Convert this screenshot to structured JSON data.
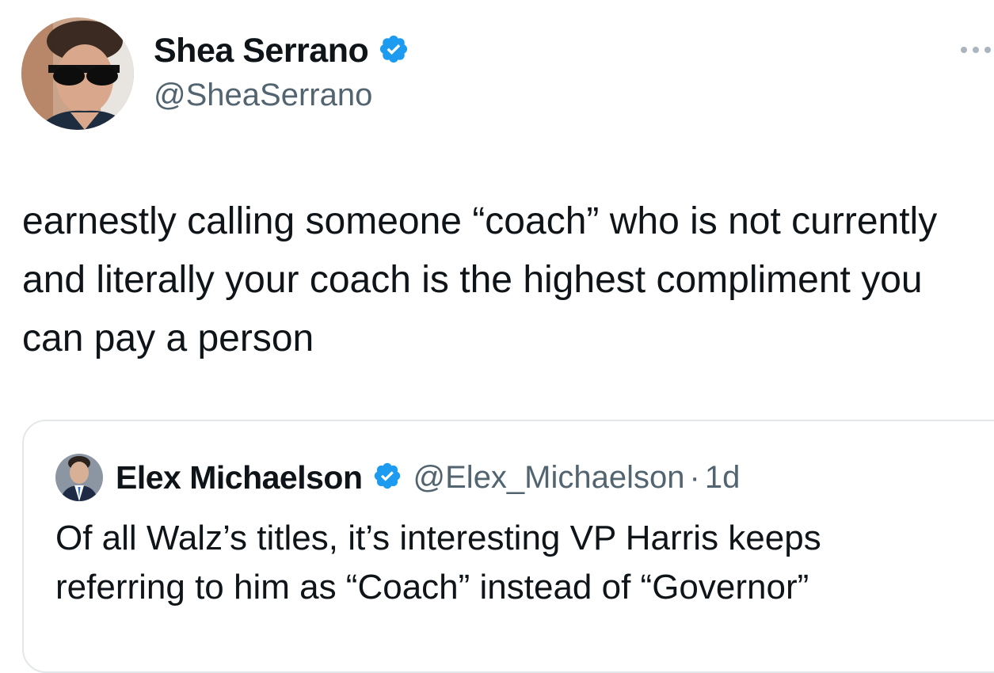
{
  "tweet": {
    "author": {
      "name": "Shea Serrano",
      "handle": "@SheaSerrano",
      "verified": true
    },
    "text": "earnestly calling someone “coach” who is not currently and literally your coach is the highest compliment you can pay a person",
    "more_icon": "more-horizontal-icon"
  },
  "quoted_tweet": {
    "author": {
      "name": "Elex Michaelson",
      "handle": "@Elex_Michaelson",
      "verified": true
    },
    "separator": "·",
    "time": "1d",
    "text": "Of all Walz’s titles, it’s interesting VP Harris keeps referring to him as “Coach” instead of “Governor”"
  },
  "colors": {
    "verified_blue": "#1d9bf0",
    "secondary_text": "#536471",
    "primary_text": "#0f1419",
    "border": "#e3e7ea"
  }
}
